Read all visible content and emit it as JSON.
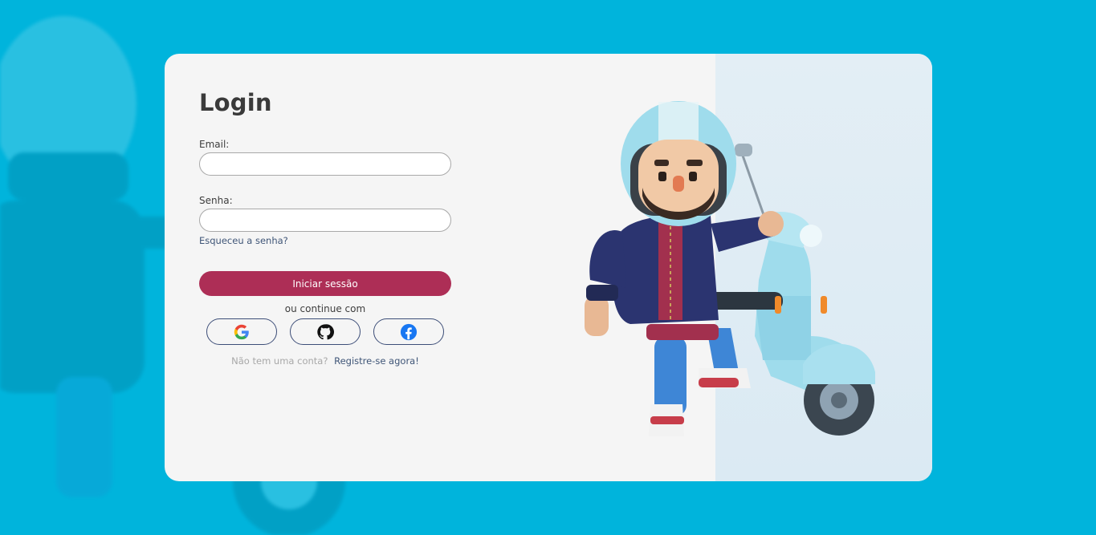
{
  "login": {
    "title": "Login",
    "email_label": "Email:",
    "email_value": "",
    "password_label": "Senha:",
    "password_value": "",
    "forgot_link": "Esqueceu a senha?",
    "submit_label": "Iniciar sessão",
    "alt_text": "ou continue com",
    "social": [
      {
        "name": "google",
        "icon": "google-icon"
      },
      {
        "name": "github",
        "icon": "github-icon"
      },
      {
        "name": "facebook",
        "icon": "facebook-icon"
      }
    ],
    "no_account_text": "Não tem uma conta?",
    "register_link": "Registre-se agora!"
  },
  "colors": {
    "page_background": "#00b4dc",
    "card_background": "#f5f5f5",
    "primary_button": "#ad2e56",
    "link": "#3f5577",
    "social_border": "#3d4e78"
  }
}
